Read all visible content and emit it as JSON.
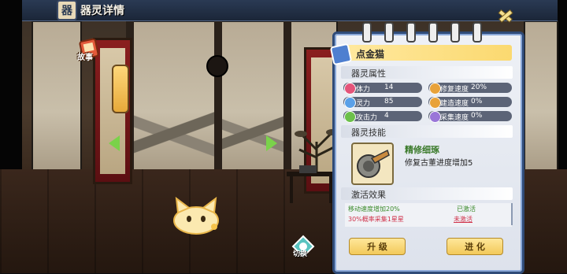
{
  "header": {
    "title": "器灵详情",
    "title_icon": "器"
  },
  "story": {
    "label": "故事"
  },
  "switch_btn": {
    "label": "切换"
  },
  "spirit": {
    "name": "点金猫",
    "attributes_title": "器灵属性",
    "stats": [
      {
        "label": "体力",
        "value": "14",
        "icon": "heart-icon",
        "color": "#e4547a"
      },
      {
        "label": "修复速度",
        "value": "20%",
        "icon": "repair-icon",
        "color": "#e8a23a"
      },
      {
        "label": "灵力",
        "value": "85",
        "icon": "spirit-drop-icon",
        "color": "#5aa0e8"
      },
      {
        "label": "建造速度",
        "value": "0%",
        "icon": "build-icon",
        "color": "#e8a23a"
      },
      {
        "label": "攻击力",
        "value": "4",
        "icon": "attack-icon",
        "color": "#6cc04a"
      },
      {
        "label": "采集速度",
        "value": "0%",
        "icon": "gather-icon",
        "color": "#9a76d8"
      }
    ],
    "skill_title": "器灵技能",
    "skill": {
      "name": "精修细琢",
      "desc": "修复古董进度增加5"
    },
    "activation_title": "激活效果",
    "activations": [
      {
        "effect": "移动速度增加20%",
        "status": "已激活",
        "effect_color": "#3a8a2a",
        "status_color": "#3a8a2a"
      },
      {
        "effect": "30%概率采集1星星",
        "status": "未激活",
        "effect_color": "#d0324a",
        "status_color": "#d0324a"
      }
    ],
    "upgrade_label": "升 级",
    "evolve_label": "进 化"
  },
  "colors": {
    "accent": "#2f4b78",
    "header_gold": "#fbd970"
  }
}
